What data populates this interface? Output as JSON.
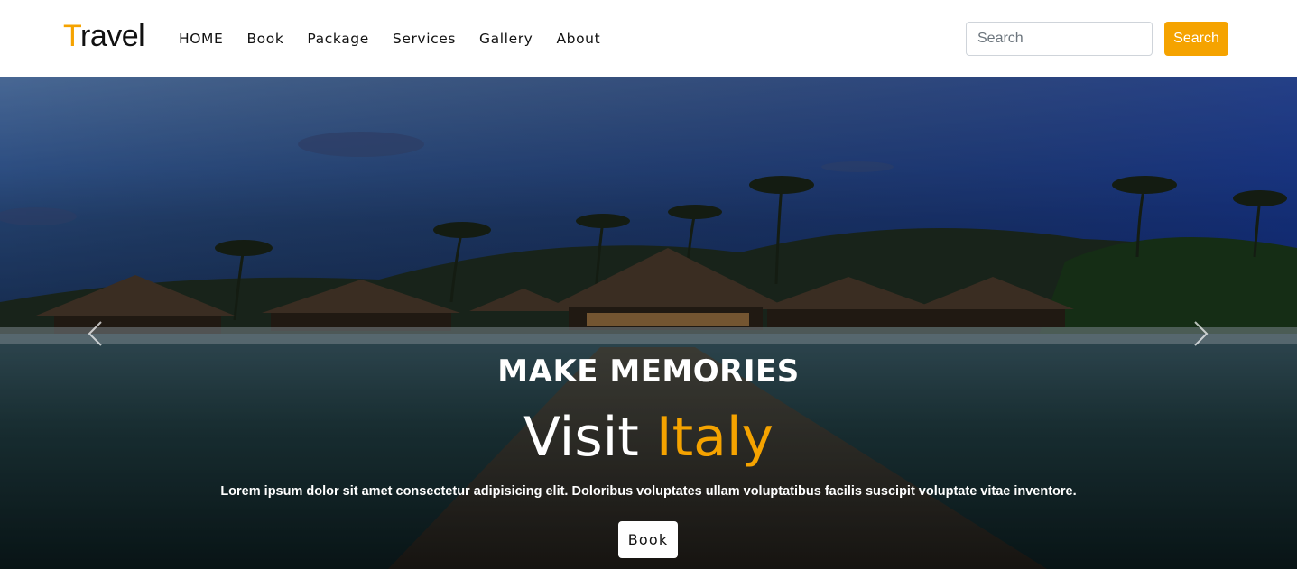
{
  "brand": {
    "first_letter": "T",
    "rest": "ravel"
  },
  "nav": {
    "items": [
      {
        "label": "HOME"
      },
      {
        "label": "Book"
      },
      {
        "label": "Package"
      },
      {
        "label": "Services"
      },
      {
        "label": "Gallery"
      },
      {
        "label": "About"
      }
    ]
  },
  "search": {
    "placeholder": "Search",
    "value": "",
    "button_label": "Search"
  },
  "hero": {
    "kicker": "MAKE MEMORIES",
    "title_main": "Visit",
    "title_accent": "Italy",
    "description": "Lorem ipsum dolor sit amet consectetur adipisicing elit. Doloribus voluptates ullam voluptatibus facilis suscipit voluptate vitae inventore.",
    "button_label": "Book",
    "prev_icon": "chevron-left-icon",
    "next_icon": "chevron-right-icon"
  },
  "colors": {
    "accent": "#f5a300",
    "text": "#111111",
    "hero_text": "#ffffff"
  }
}
